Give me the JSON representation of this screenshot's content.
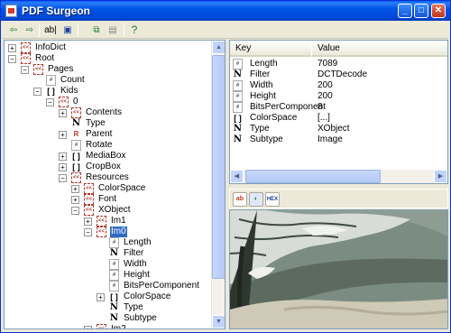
{
  "window": {
    "title": "PDF Surgeon"
  },
  "window_buttons": {
    "minimize": "_",
    "maximize": "□",
    "close": "✕"
  },
  "toolbar": {
    "tools": [
      {
        "name": "open-icon",
        "glyph": "⇦"
      },
      {
        "name": "save-icon",
        "glyph": "⇨"
      },
      {
        "name": "text-edit-icon",
        "glyph": "ab|"
      },
      {
        "name": "disk-icon",
        "glyph": "▣"
      },
      {
        "name": "copy-icon",
        "glyph": "⧉"
      },
      {
        "name": "paste-icon",
        "glyph": "▤"
      },
      {
        "name": "help-icon",
        "glyph": "?"
      }
    ]
  },
  "tree": {
    "nodes": [
      {
        "label": "InfoDict",
        "depth": 0,
        "expander": "+",
        "icon": "dict"
      },
      {
        "label": "Root",
        "depth": 0,
        "expander": "−",
        "icon": "dict"
      },
      {
        "label": "Pages",
        "depth": 1,
        "expander": "−",
        "icon": "dict"
      },
      {
        "label": "Count",
        "depth": 2,
        "expander": "",
        "icon": "num"
      },
      {
        "label": "Kids",
        "depth": 2,
        "expander": "−",
        "icon": "arr"
      },
      {
        "label": "0",
        "depth": 3,
        "expander": "−",
        "icon": "dict"
      },
      {
        "label": "Contents",
        "depth": 4,
        "expander": "+",
        "icon": "dict"
      },
      {
        "label": "Type",
        "depth": 4,
        "expander": "",
        "icon": "name"
      },
      {
        "label": "Parent",
        "depth": 4,
        "expander": "+",
        "icon": "ref"
      },
      {
        "label": "Rotate",
        "depth": 4,
        "expander": "",
        "icon": "num"
      },
      {
        "label": "MediaBox",
        "depth": 4,
        "expander": "+",
        "icon": "arr"
      },
      {
        "label": "CropBox",
        "depth": 4,
        "expander": "+",
        "icon": "arr"
      },
      {
        "label": "Resources",
        "depth": 4,
        "expander": "−",
        "icon": "dict"
      },
      {
        "label": "ColorSpace",
        "depth": 5,
        "expander": "+",
        "icon": "dict"
      },
      {
        "label": "Font",
        "depth": 5,
        "expander": "+",
        "icon": "dict"
      },
      {
        "label": "XObject",
        "depth": 5,
        "expander": "−",
        "icon": "dict"
      },
      {
        "label": "Im1",
        "depth": 6,
        "expander": "+",
        "icon": "dict"
      },
      {
        "label": "Im0",
        "depth": 6,
        "expander": "−",
        "icon": "dict",
        "selected": true
      },
      {
        "label": "Length",
        "depth": 7,
        "expander": "",
        "icon": "num"
      },
      {
        "label": "Filter",
        "depth": 7,
        "expander": "",
        "icon": "name"
      },
      {
        "label": "Width",
        "depth": 7,
        "expander": "",
        "icon": "num"
      },
      {
        "label": "Height",
        "depth": 7,
        "expander": "",
        "icon": "num"
      },
      {
        "label": "BitsPerComponent",
        "depth": 7,
        "expander": "",
        "icon": "num"
      },
      {
        "label": "ColorSpace",
        "depth": 7,
        "expander": "+",
        "icon": "arr"
      },
      {
        "label": "Type",
        "depth": 7,
        "expander": "",
        "icon": "name"
      },
      {
        "label": "Subtype",
        "depth": 7,
        "expander": "",
        "icon": "name"
      },
      {
        "label": "Im2",
        "depth": 6,
        "expander": "+",
        "icon": "dict"
      }
    ]
  },
  "properties": {
    "columns": {
      "key": "Key",
      "value": "Value"
    },
    "rows": [
      {
        "key": "Length",
        "value": "7089",
        "icon": "num"
      },
      {
        "key": "Filter",
        "value": "DCTDecode",
        "icon": "name"
      },
      {
        "key": "Width",
        "value": "200",
        "icon": "num"
      },
      {
        "key": "Height",
        "value": "200",
        "icon": "num"
      },
      {
        "key": "BitsPerComponent",
        "value": "8",
        "icon": "num"
      },
      {
        "key": "ColorSpace",
        "value": "[...]",
        "icon": "arr"
      },
      {
        "key": "Type",
        "value": "XObject",
        "icon": "name"
      },
      {
        "key": "Subtype",
        "value": "Image",
        "icon": "name"
      }
    ]
  },
  "image_toolbar": {
    "buttons": [
      {
        "name": "text-view-icon",
        "glyph": "ab"
      },
      {
        "name": "image-view-icon",
        "glyph": "◐"
      },
      {
        "name": "hex-view-icon",
        "glyph": "HEX"
      }
    ]
  }
}
